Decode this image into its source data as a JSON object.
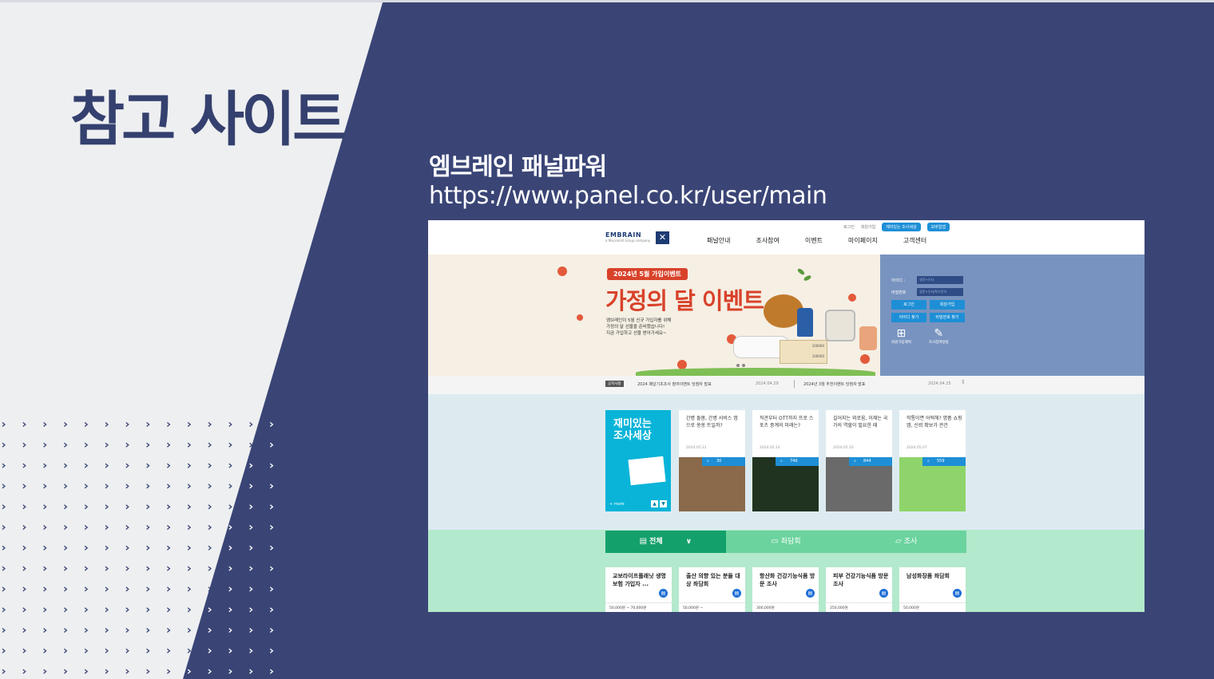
{
  "slide": {
    "title": "참고 사이트",
    "site_name": "엠브레인 패널파워",
    "site_url": "https://www.panel.co.kr/user/main"
  },
  "colors": {
    "navy": "#3a4576",
    "light": "#eeeff1",
    "title": "#34406e",
    "accent_blue": "#1e8fd6",
    "accent_red": "#d8422a",
    "green": "#14a06a"
  },
  "screenshot": {
    "utility": {
      "login": "로그인",
      "join": "회원가입",
      "fun": "재미있는 조사세상",
      "mobile": "모바일앱"
    },
    "logo": {
      "brand": "EMBRAIN",
      "sub": "a Macromill Group company",
      "mark": "logo-mark-icon"
    },
    "nav": [
      "패널안내",
      "조사참여",
      "이벤트",
      "마이페이지",
      "고객센터"
    ],
    "hero": {
      "pill": "2024년 5월 가입이벤트",
      "title": "가정의 달 이벤트",
      "desc1": "엠브레인이 5월 신규 가입자를 위해",
      "desc2": "가정의 달 선물을 준비했습니다!",
      "desc3": "지금 가입하고 선물 받아가세요~",
      "money1": "100000",
      "money2": "100000"
    },
    "login": {
      "id_label": "아이디 :",
      "id_placeholder": "영문+숫자",
      "pw_label": "비밀번호",
      "pw_placeholder": "영문+숫자/특수문자",
      "login_btn": "로그인",
      "join_btn": "회원가입",
      "find_id": "아이디 찾기",
      "find_pw": "비밀번호 찾기",
      "benefit": "회원가입혜택",
      "how": "조사참여방법"
    },
    "notice": {
      "tag": "공지사항",
      "items": [
        {
          "title": "2024 패널기초조사 참여이벤트 당첨자 발표",
          "date": "2024.04.29"
        },
        {
          "title": "2024년 3월 추천이벤트 당첨자 발표",
          "date": "2024.04.25"
        }
      ]
    },
    "fun": {
      "title": "재미있는 조사세상",
      "more": "+ more",
      "items": [
        {
          "title": "간병 돌봄, 간병 서비스 앱으로 쏭쏭 트일까?",
          "date": "2024.05.21",
          "count": "30",
          "img": "#8a6a4a"
        },
        {
          "title": "직관부터 OTT까지 프로 스포츠 중계의 미래는?",
          "date": "2024.05.14",
          "count": "740",
          "img": "#1f3320"
        },
        {
          "title": "길어지는 외로움, 이제는 국가의 역할이 필요한 때",
          "date": "2024.05.10",
          "count": "844",
          "img": "#6a6a6a"
        },
        {
          "title": "학통이면 어떡해? 명품 쇼핑 앱, 신뢰 확보가 관건",
          "date": "2024.05.07",
          "count": "559",
          "img": "#8fd46a"
        }
      ]
    },
    "tabs": [
      {
        "label": "전체",
        "icon": "document-icon"
      },
      {
        "label": "좌담회",
        "icon": "chat-icon"
      },
      {
        "label": "조사",
        "icon": "survey-icon"
      }
    ],
    "surveys": [
      {
        "title": "교보라이프플래닛 생명 보험 가입자 ...",
        "price": "50,000원 ~ 70,000원"
      },
      {
        "title": "출산 의향 있는 분들 대상 좌담회",
        "price": "50,000원 ~"
      },
      {
        "title": "항산화 건강기능식품 방문 조사",
        "price": "300,000원"
      },
      {
        "title": "피부 건강기능식품 방문 조사",
        "price": "250,000원"
      },
      {
        "title": "남성화장품 좌담회",
        "price": "50,000원"
      }
    ]
  }
}
